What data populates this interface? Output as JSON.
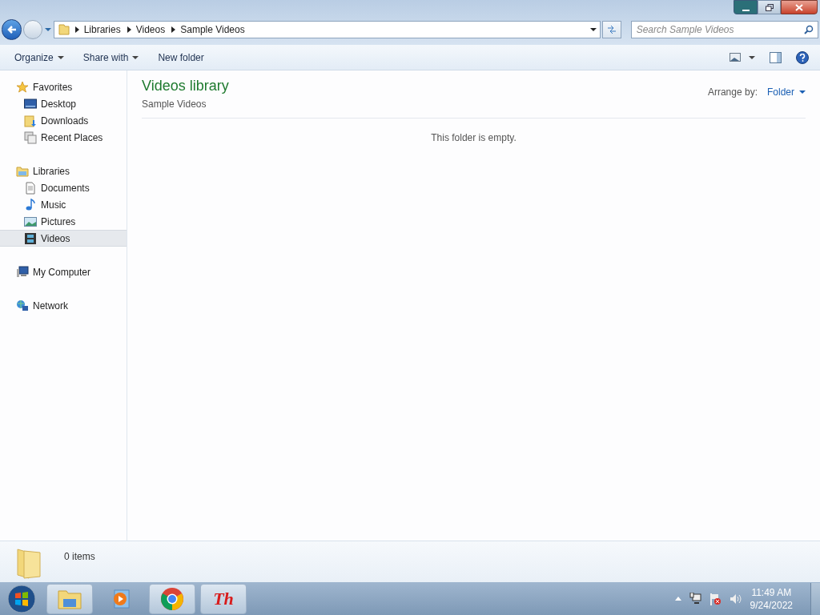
{
  "address": {
    "crumbs": [
      "Libraries",
      "Videos",
      "Sample Videos"
    ]
  },
  "search": {
    "placeholder": "Search Sample Videos"
  },
  "toolbar": {
    "buttons": [
      {
        "label": "Organize",
        "dropdown": true
      },
      {
        "label": "Share with",
        "dropdown": true
      },
      {
        "label": "New folder",
        "dropdown": false
      }
    ]
  },
  "sidebar": {
    "groups": [
      {
        "label": "Favorites",
        "kind": "star",
        "selected": false,
        "children": [
          {
            "label": "Desktop",
            "kind": "desktop",
            "selected": false
          },
          {
            "label": "Downloads",
            "kind": "downloads",
            "selected": false
          },
          {
            "label": "Recent Places",
            "kind": "recent",
            "selected": false
          }
        ]
      },
      {
        "label": "Libraries",
        "kind": "library",
        "selected": false,
        "children": [
          {
            "label": "Documents",
            "kind": "document",
            "selected": false
          },
          {
            "label": "Music",
            "kind": "music",
            "selected": false
          },
          {
            "label": "Pictures",
            "kind": "pictures",
            "selected": false
          },
          {
            "label": "Videos",
            "kind": "film",
            "selected": true
          }
        ]
      },
      {
        "label": "My Computer",
        "kind": "computer",
        "selected": false
      },
      {
        "label": "Network",
        "kind": "network",
        "selected": false
      }
    ]
  },
  "content": {
    "title": "Videos library",
    "subtitle": "Sample Videos",
    "arrange_label": "Arrange by:",
    "arrange_value": "Folder",
    "empty_message": "This folder is empty."
  },
  "details": {
    "count": "0 items"
  },
  "taskbar": {
    "apps": [
      {
        "kind": "explorer",
        "active": true
      },
      {
        "kind": "media",
        "active": false
      },
      {
        "kind": "chrome",
        "active": true
      },
      {
        "kind": "textlogo",
        "label": "Th",
        "active": true
      }
    ],
    "time": "11:49 AM",
    "date": "9/24/2022"
  }
}
